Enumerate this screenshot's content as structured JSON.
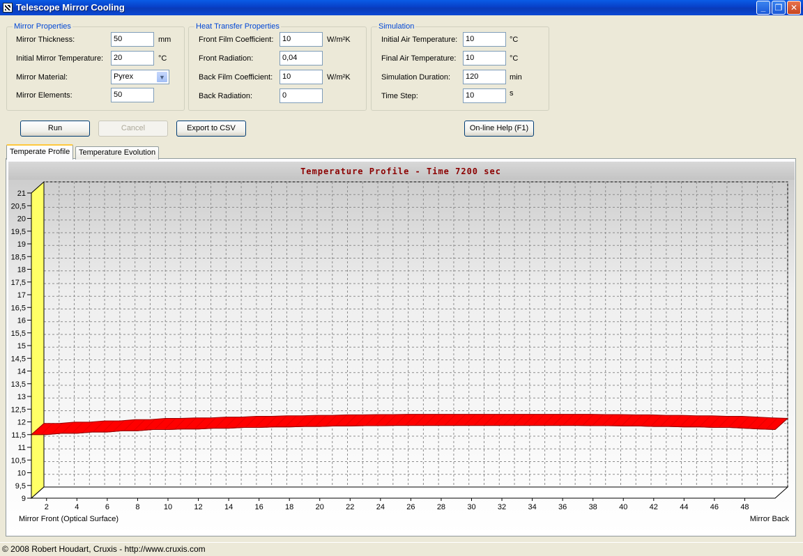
{
  "window": {
    "title": "Telescope Mirror Cooling",
    "minimize_icon": "minimize-icon",
    "restore_icon": "restore-icon",
    "close_icon": "close-icon"
  },
  "mirror": {
    "legend": "Mirror Properties",
    "thickness_label": "Mirror Thickness:",
    "thickness_value": "50",
    "thickness_unit": "mm",
    "init_temp_label": "Initial Mirror Temperature:",
    "init_temp_value": "20",
    "init_temp_unit": "°C",
    "material_label": "Mirror Material:",
    "material_value": "Pyrex",
    "elements_label": "Mirror Elements:",
    "elements_value": "50"
  },
  "heat": {
    "legend": "Heat Transfer Properties",
    "front_film_label": "Front Film Coefficient:",
    "front_film_value": "10",
    "front_film_unit": "W/m²K",
    "front_rad_label": "Front Radiation:",
    "front_rad_value": "0,04",
    "back_film_label": "Back Film Coefficient:",
    "back_film_value": "10",
    "back_film_unit": "W/m²K",
    "back_rad_label": "Back Radiation:",
    "back_rad_value": "0"
  },
  "sim": {
    "legend": "Simulation",
    "init_air_label": "Initial Air Temperature:",
    "init_air_value": "10",
    "init_air_unit": "°C",
    "final_air_label": "Final Air Temperature:",
    "final_air_value": "10",
    "final_air_unit": "°C",
    "duration_label": "Simulation Duration:",
    "duration_value": "120",
    "duration_unit": "min",
    "step_label": "Time Step:",
    "step_value": "10",
    "step_unit": "s"
  },
  "buttons": {
    "run": "Run",
    "cancel": "Cancel",
    "export": "Export to CSV",
    "help": "On-line Help (F1)"
  },
  "tabs": [
    "Temperate Profile",
    "Temperature Evolution"
  ],
  "chart_data": {
    "type": "area",
    "title": "Temperature Profile - Time 7200 sec",
    "xlabel_left": "Mirror Front (Optical Surface)",
    "xlabel_right": "Mirror Back",
    "ylim": [
      9,
      21
    ],
    "yticks": [
      "21",
      "20,5",
      "20",
      "19,5",
      "19",
      "18,5",
      "18",
      "17,5",
      "17",
      "16,5",
      "16",
      "15,5",
      "15",
      "14,5",
      "14",
      "13,5",
      "13",
      "12,5",
      "12",
      "11,5",
      "11",
      "10,5",
      "10",
      "9,5",
      "9"
    ],
    "xticks": [
      "2",
      "4",
      "6",
      "8",
      "10",
      "12",
      "14",
      "16",
      "18",
      "20",
      "22",
      "24",
      "26",
      "28",
      "30",
      "32",
      "34",
      "36",
      "38",
      "40",
      "42",
      "44",
      "46",
      "48"
    ],
    "grid": true,
    "x": [
      1,
      2,
      3,
      4,
      5,
      6,
      7,
      8,
      9,
      10,
      11,
      12,
      13,
      14,
      15,
      16,
      17,
      18,
      19,
      20,
      21,
      22,
      23,
      24,
      25,
      26,
      27,
      28,
      29,
      30,
      31,
      32,
      33,
      34,
      35,
      36,
      37,
      38,
      39,
      40,
      41,
      42,
      43,
      44,
      45,
      46,
      47,
      48,
      49,
      50
    ],
    "values": [
      11.5,
      11.5,
      11.55,
      11.55,
      11.6,
      11.6,
      11.65,
      11.65,
      11.7,
      11.7,
      11.72,
      11.72,
      11.75,
      11.75,
      11.78,
      11.78,
      11.8,
      11.8,
      11.82,
      11.82,
      11.84,
      11.84,
      11.85,
      11.85,
      11.86,
      11.86,
      11.86,
      11.86,
      11.86,
      11.86,
      11.86,
      11.86,
      11.86,
      11.86,
      11.86,
      11.86,
      11.86,
      11.85,
      11.85,
      11.84,
      11.84,
      11.82,
      11.82,
      11.8,
      11.8,
      11.78,
      11.78,
      11.75,
      11.72,
      11.7
    ],
    "series_color": "#ff0000",
    "wall_color": "#ffff66"
  },
  "status": {
    "text": "© 2008 Robert Houdart, Cruxis  -  http://www.cruxis.com"
  }
}
